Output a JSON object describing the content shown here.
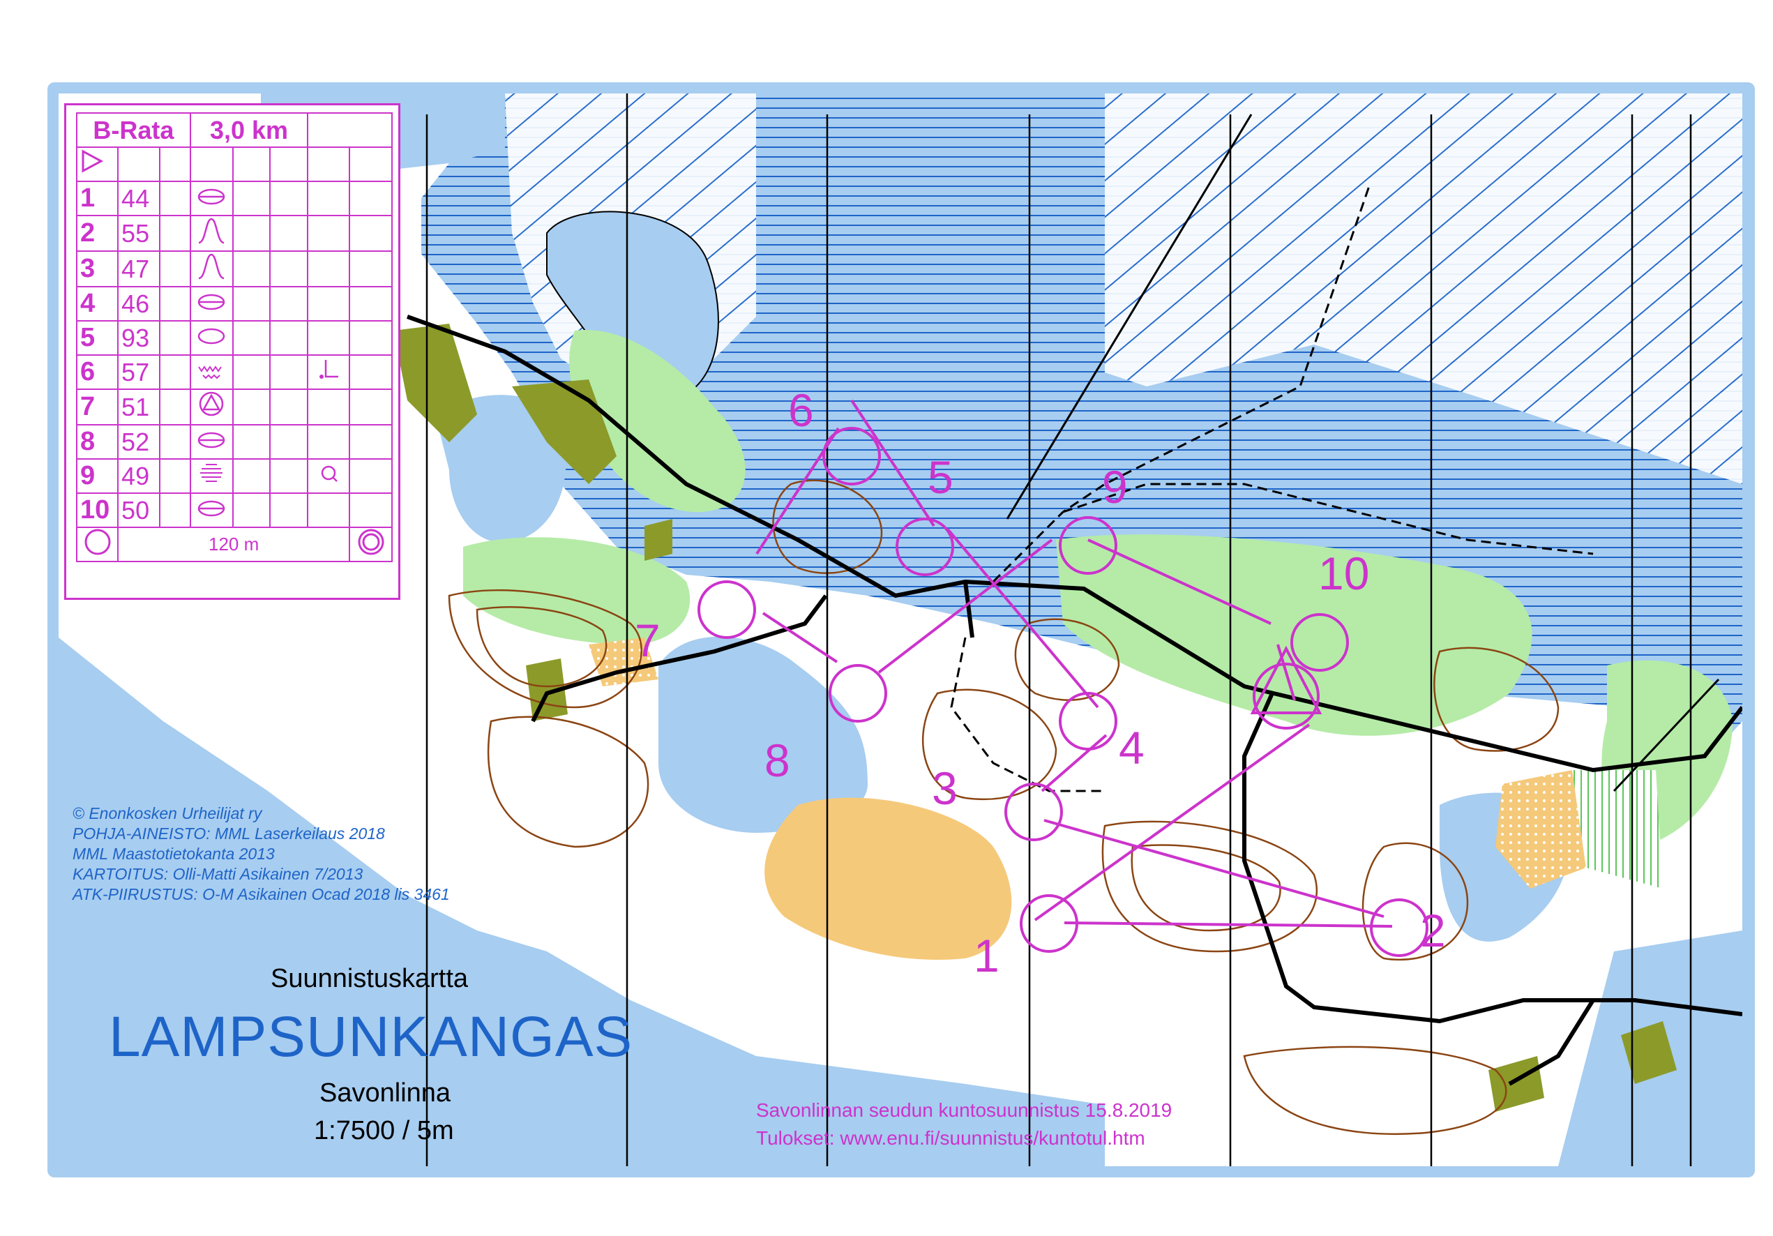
{
  "card": {
    "course": "B-Rata",
    "length": "3,0 km",
    "start_symbol": "triangle",
    "controls": [
      {
        "num": "1",
        "code": "44",
        "feature": "knoll-icon",
        "extra": ""
      },
      {
        "num": "2",
        "code": "55",
        "feature": "spur-icon",
        "extra": ""
      },
      {
        "num": "3",
        "code": "47",
        "feature": "spur-icon",
        "extra": ""
      },
      {
        "num": "4",
        "code": "46",
        "feature": "knoll-icon",
        "extra": ""
      },
      {
        "num": "5",
        "code": "93",
        "feature": "oval-icon",
        "extra": ""
      },
      {
        "num": "6",
        "code": "57",
        "feature": "marsh-icon",
        "extra": "corner-icon"
      },
      {
        "num": "7",
        "code": "51",
        "feature": "boulder-icon",
        "extra": ""
      },
      {
        "num": "8",
        "code": "52",
        "feature": "knoll-icon",
        "extra": ""
      },
      {
        "num": "9",
        "code": "49",
        "feature": "marsh-line-icon",
        "extra": "small-knoll-icon"
      },
      {
        "num": "10",
        "code": "50",
        "feature": "knoll-icon",
        "extra": ""
      }
    ],
    "finish_distance": "120 m"
  },
  "credits": [
    "©  Enonkosken Urheilijat ry",
    "POHJA-AINEISTO: MML Laserkeilaus 2018",
    "MML Maastotietokanta 2013",
    "KARTOITUS: Olli-Matti Asikainen 7/2013",
    "ATK-PIIRUSTUS: O-M Asikainen Ocad 2018 lis 3461"
  ],
  "title": {
    "kind": "Suunnistuskartta",
    "name": "LAMPSUNKANGAS",
    "city": "Savonlinna",
    "scale": "1:7500 / 5m"
  },
  "event": {
    "line1": "Savonlinnan seudun kuntosuunnistus 15.8.2019",
    "line2": "Tulokset: www.enu.fi/suunnistus/kuntotul.htm"
  },
  "course_labels": [
    "1",
    "2",
    "3",
    "4",
    "5",
    "6",
    "7",
    "8",
    "9",
    "10"
  ],
  "colors": {
    "course": "#cc33cc",
    "water": "#a7cdf0",
    "water_line": "#1e64c8",
    "green": "#b5eba7",
    "contour": "#8b4513",
    "open": "#f5c97a",
    "marsh_green": "#8c9a2a"
  }
}
